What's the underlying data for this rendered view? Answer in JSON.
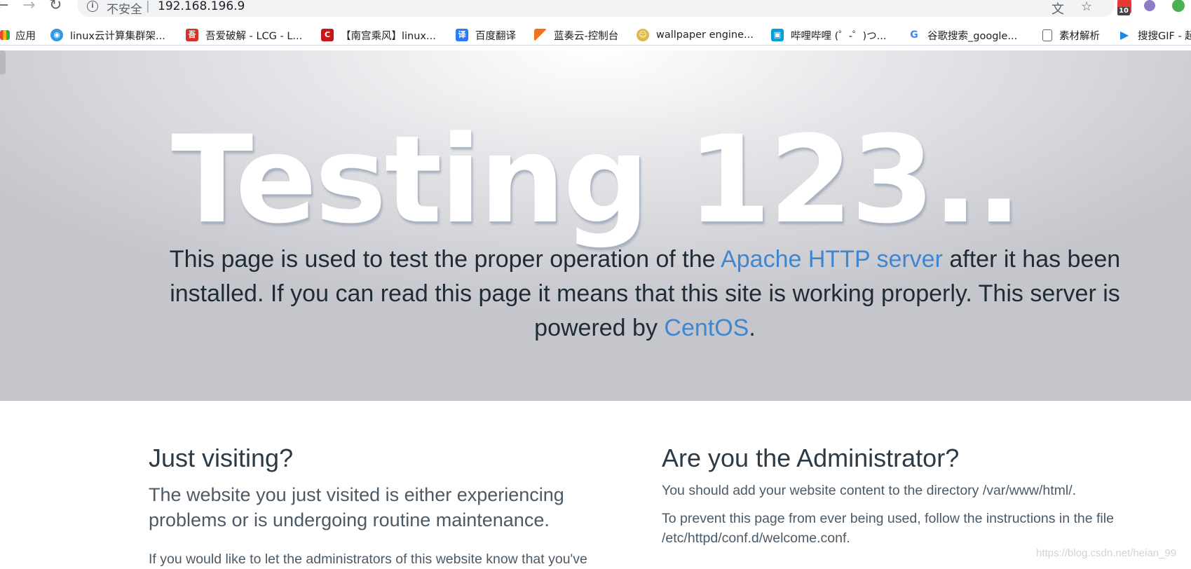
{
  "browser": {
    "security_label": "不安全",
    "separator": "|",
    "url": "192.168.196.9",
    "extension_badge": "10",
    "bookmarks": [
      {
        "label": "应用",
        "color": "#e8453c"
      },
      {
        "label": "linux云计算集群架...",
        "color": "#2b9ae3"
      },
      {
        "label": "吾爱破解 - LCG - L...",
        "color": "#d93025"
      },
      {
        "label": "【南宫乘风】linux...",
        "color": "#c8161d"
      },
      {
        "label": "百度翻译",
        "color": "#2979ff"
      },
      {
        "label": "蓝奏云-控制台",
        "color": "#f37021"
      },
      {
        "label": "wallpaper engine...",
        "color": "#e0b84a"
      },
      {
        "label": "哔哩哔哩 (゜-゜)つ...",
        "color": "#00a1d6"
      },
      {
        "label": "谷歌搜索_google...",
        "color": "#4285f4"
      },
      {
        "label": "素材解析",
        "color": "#5f6368"
      },
      {
        "label": "搜搜GIF - 起",
        "color": "#1e88e5"
      }
    ]
  },
  "hero": {
    "title": "Testing 123..",
    "text_before": "This page is used to test the proper operation of the ",
    "link_apache": "Apache HTTP server",
    "text_middle": " after it has been installed. If you can read this page it means that this site is working properly. This server is powered by ",
    "link_centos": "CentOS",
    "text_end": "."
  },
  "left_column": {
    "heading": "Just visiting?",
    "lead": "The website you just visited is either experiencing problems or is undergoing routine maintenance.",
    "paragraph": "If you would like to let the administrators of this website know that you've"
  },
  "right_column": {
    "heading": "Are you the Administrator?",
    "paragraph1": "You should add your website content to the directory /var/www/html/.",
    "paragraph2": "To prevent this page from ever being used, follow the instructions in the file /etc/httpd/conf.d/welcome.conf."
  },
  "watermark": "https://blog.csdn.net/heian_99",
  "colors": {
    "link": "#3f86d0",
    "hero_bg": "#c5c6cc"
  }
}
